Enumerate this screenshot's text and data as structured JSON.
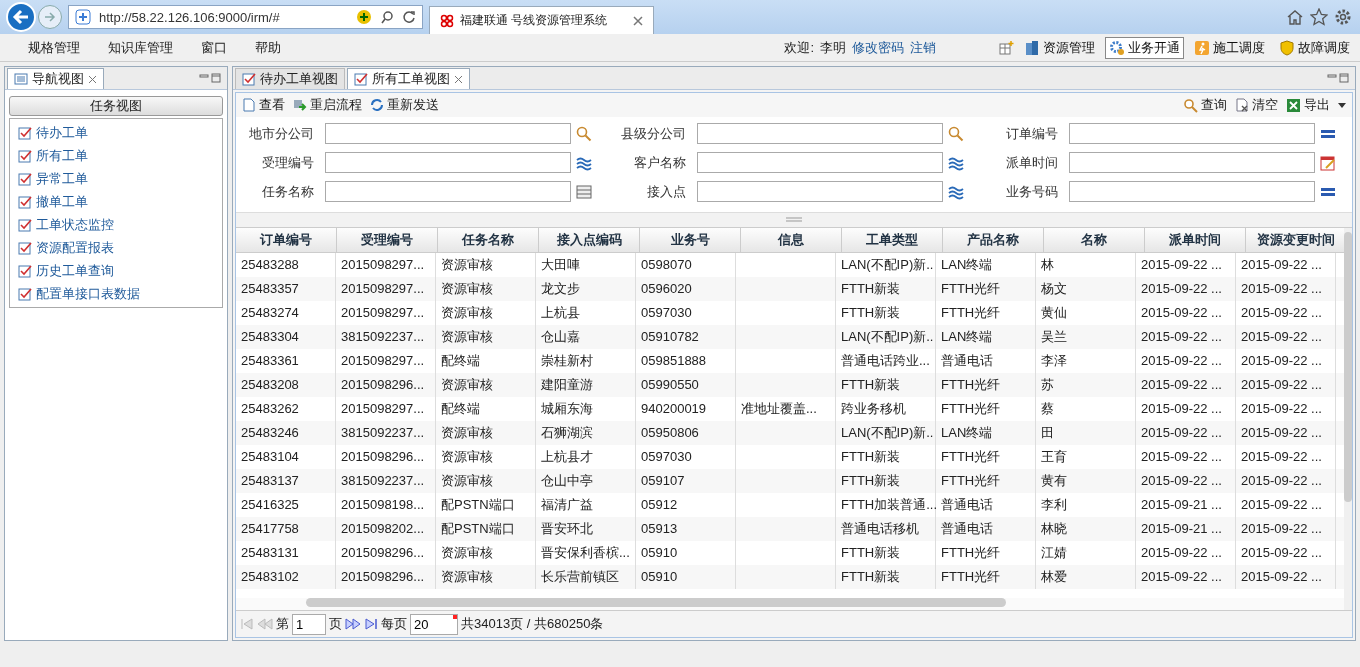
{
  "browser": {
    "url": "http://58.22.126.106:9000/irm/#",
    "tab_title": "福建联通 号线资源管理系统"
  },
  "menu": [
    "规格管理",
    "知识库管理",
    "窗口",
    "帮助"
  ],
  "user": {
    "welcome": "欢迎:",
    "name": "李明",
    "links": [
      "修改密码",
      "注销"
    ]
  },
  "modules": [
    {
      "label": "资源管理",
      "selected": false,
      "kind": "building"
    },
    {
      "label": "业务开通",
      "selected": true,
      "kind": "gear"
    },
    {
      "label": "施工调度",
      "selected": false,
      "kind": "worker"
    },
    {
      "label": "故障调度",
      "selected": false,
      "kind": "shield"
    }
  ],
  "nav": {
    "title": "导航视图",
    "section": "任务视图",
    "items": [
      "待办工单",
      "所有工单",
      "异常工单",
      "撤单工单",
      "工单状态监控",
      "资源配置报表",
      "历史工单查询",
      "配置单接口表数据"
    ]
  },
  "tabs": [
    {
      "label": "待办工单视图",
      "selected": false,
      "closable": false
    },
    {
      "label": "所有工单视图",
      "selected": true,
      "closable": true
    }
  ],
  "toolbar": [
    {
      "label": "查看",
      "kind": "doc"
    },
    {
      "label": "重启流程",
      "kind": "restart"
    },
    {
      "label": "重新发送",
      "kind": "refresh"
    }
  ],
  "actions": [
    {
      "label": "查询",
      "kind": "search"
    },
    {
      "label": "清空",
      "kind": "clear"
    },
    {
      "label": "导出",
      "kind": "excel"
    }
  ],
  "filters": [
    [
      {
        "label": "地市分公司",
        "kind": "lookup"
      },
      {
        "label": "县级分公司",
        "kind": "lookup"
      },
      {
        "label": "订单编号",
        "kind": "multi"
      }
    ],
    [
      {
        "label": "受理编号",
        "kind": "wave"
      },
      {
        "label": "客户名称",
        "kind": "wave"
      },
      {
        "label": "派单时间",
        "kind": "date"
      }
    ],
    [
      {
        "label": "任务名称",
        "kind": "list"
      },
      {
        "label": "接入点",
        "kind": "wave"
      },
      {
        "label": "业务号码",
        "kind": "multi"
      }
    ]
  ],
  "table": {
    "columns": [
      "订单编号",
      "受理编号",
      "任务名称",
      "接入点编码",
      "业务号",
      "信息",
      "工单类型",
      "产品名称",
      "名称",
      "派单时间",
      "资源变更时间"
    ],
    "rows": [
      [
        "25483288",
        "2015098297...",
        "资源审核",
        "大田唓",
        "0598070",
        "",
        "LAN(不配IP)新..",
        "LAN终端",
        "林",
        "2015-09-22 ...",
        "2015-09-22 ..."
      ],
      [
        "25483357",
        "2015098297...",
        "资源审核",
        "龙文步",
        "0596020",
        "",
        "FTTH新装",
        "FTTH光纤",
        "杨文",
        "2015-09-22 ...",
        "2015-09-22 ..."
      ],
      [
        "25483274",
        "2015098297...",
        "资源审核",
        "上杭县",
        "0597030",
        "",
        "FTTH新装",
        "FTTH光纤",
        "黄仙",
        "2015-09-22 ...",
        "2015-09-22 ..."
      ],
      [
        "25483304",
        "3815092237...",
        "资源审核",
        "仓山嘉",
        "05910782",
        "",
        "LAN(不配IP)新..",
        "LAN终端",
        "吴兰",
        "2015-09-22 ...",
        "2015-09-22 ..."
      ],
      [
        "25483361",
        "2015098297...",
        "配终端",
        "崇桂新村",
        "059851888",
        "",
        "普通电话跨业...",
        "普通电话",
        "李泽",
        "2015-09-22 ...",
        "2015-09-22 ..."
      ],
      [
        "25483208",
        "2015098296...",
        "资源审核",
        "建阳童游",
        "05990550",
        "",
        "FTTH新装",
        "FTTH光纤",
        "苏",
        "2015-09-22 ...",
        "2015-09-22 ..."
      ],
      [
        "25483262",
        "2015098297...",
        "配终端",
        "城厢东海",
        "940200019",
        "准地址覆盖...",
        "跨业务移机",
        "FTTH光纤",
        "蔡",
        "2015-09-22 ...",
        "2015-09-22 ..."
      ],
      [
        "25483246",
        "3815092237...",
        "资源审核",
        "石狮湖滨",
        "05950806",
        "",
        "LAN(不配IP)新..",
        "LAN终端",
        "田",
        "2015-09-22 ...",
        "2015-09-22 ..."
      ],
      [
        "25483104",
        "2015098296...",
        "资源审核",
        "上杭县才",
        "0597030",
        "",
        "FTTH新装",
        "FTTH光纤",
        "王育",
        "2015-09-22 ...",
        "2015-09-22 ..."
      ],
      [
        "25483137",
        "3815092237...",
        "资源审核",
        "仓山中亭",
        "059107",
        "",
        "FTTH新装",
        "FTTH光纤",
        "黄有",
        "2015-09-22 ...",
        "2015-09-22 ..."
      ],
      [
        "25416325",
        "2015098198...",
        "配PSTN端口",
        "福清广益",
        "05912",
        "",
        "FTTH加装普通...",
        "普通电话",
        "李利",
        "2015-09-21 ...",
        "2015-09-22 ..."
      ],
      [
        "25417758",
        "2015098202...",
        "配PSTN端口",
        "晋安环北",
        "05913",
        "",
        "普通电话移机",
        "普通电话",
        "林晓",
        "2015-09-21 ...",
        "2015-09-22 ..."
      ],
      [
        "25483131",
        "2015098296...",
        "资源审核",
        "晋安保利香槟...",
        "05910",
        "",
        "FTTH新装",
        "FTTH光纤",
        "江婧",
        "2015-09-22 ...",
        "2015-09-22 ..."
      ],
      [
        "25483102",
        "2015098296...",
        "资源审核",
        "长乐营前镇区",
        "05910",
        "",
        "FTTH新装",
        "FTTH光纤",
        "林爱",
        "2015-09-22 ...",
        "2015-09-22 ..."
      ]
    ]
  },
  "pager": {
    "page_label": "第",
    "page": "1",
    "page_unit": "页",
    "per_page_label": "每页",
    "per_page": "20",
    "summary": "共34013页 / 共680250条"
  }
}
